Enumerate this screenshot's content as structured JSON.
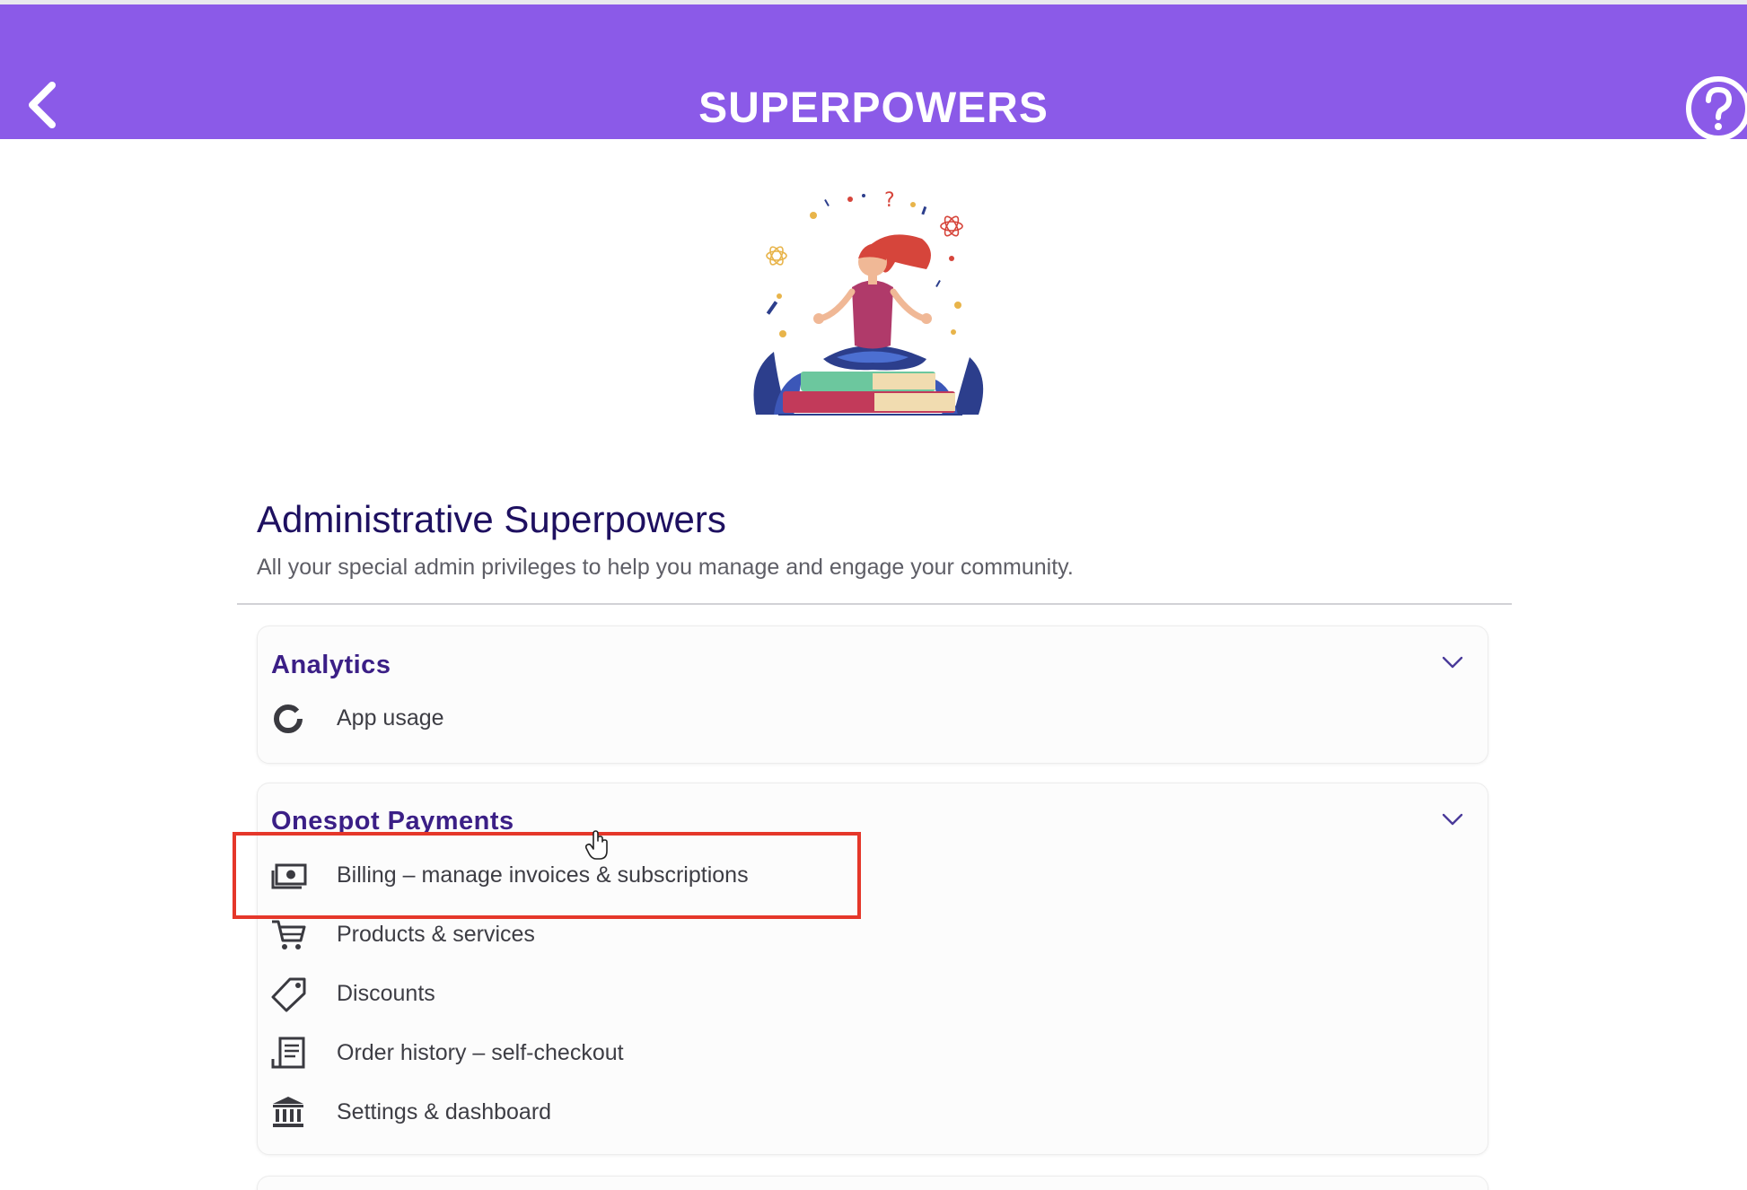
{
  "header": {
    "title": "SUPERPOWERS",
    "back_icon": "chevron-left-icon",
    "help_icon": "question-circle-icon",
    "background": "#8b5ae8"
  },
  "hero": {
    "illustration": "meditating-woman-on-books-illustration"
  },
  "section": {
    "title": "Administrative Superpowers",
    "subtitle": "All your special admin privileges to help you manage and engage your community."
  },
  "cards": {
    "analytics": {
      "title": "Analytics",
      "items": [
        {
          "label": "App usage",
          "icon": "ring-chart-icon"
        }
      ]
    },
    "payments": {
      "title": "Onespot Payments",
      "items": [
        {
          "label": "Billing – manage invoices & subscriptions",
          "icon": "money-icon"
        },
        {
          "label": "Products & services",
          "icon": "cart-icon"
        },
        {
          "label": "Discounts",
          "icon": "tag-icon"
        },
        {
          "label": "Order history – self-checkout",
          "icon": "receipt-icon"
        },
        {
          "label": "Settings & dashboard",
          "icon": "bank-icon"
        }
      ]
    }
  },
  "colors": {
    "accent": "#8b5ae8",
    "card_title": "#3b1f86",
    "heading": "#1e1060",
    "highlight": "#e5372a"
  }
}
